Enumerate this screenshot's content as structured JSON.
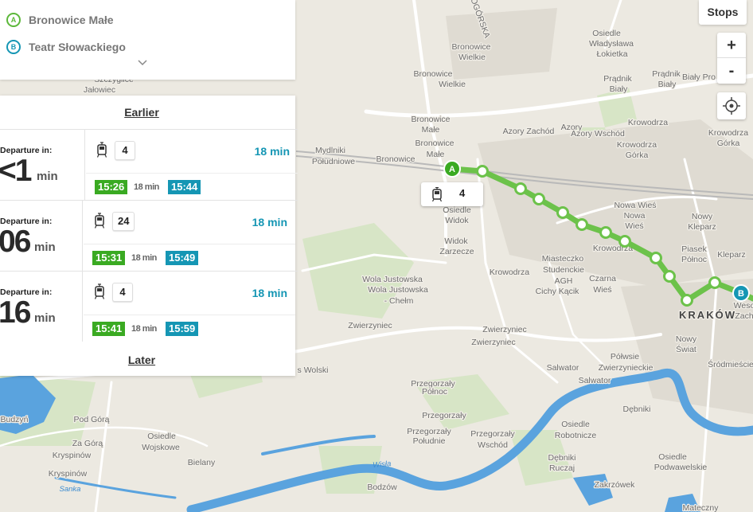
{
  "origin": {
    "marker": "A",
    "name": "Bronowice Małe",
    "color": "#5cb83a"
  },
  "destination": {
    "marker": "B",
    "name": "Teatr Słowackiego",
    "color": "#1596b4"
  },
  "departures_panel": {
    "earlier_label": "Earlier",
    "later_label": "Later",
    "trips": [
      {
        "caption": "Departure in:",
        "big": "<1",
        "unit": "min",
        "line": "4",
        "duration": "18 min",
        "dep_time": "15:26",
        "ride": "18 min",
        "arr_time": "15:44"
      },
      {
        "caption": "Departure in:",
        "big": "06",
        "unit": "min",
        "line": "24",
        "duration": "18 min",
        "dep_time": "15:31",
        "ride": "18 min",
        "arr_time": "15:49"
      },
      {
        "caption": "Departure in:",
        "big": "16",
        "unit": "min",
        "line": "4",
        "duration": "18 min",
        "dep_time": "15:41",
        "ride": "18 min",
        "arr_time": "15:59"
      }
    ]
  },
  "map_controls": {
    "stops_label": "Stops",
    "zoom_in": "+",
    "zoom_out": "-",
    "locate_icon": "crosshair-icon"
  },
  "map_tooltip": {
    "icon": "tram-icon",
    "line": "4"
  },
  "map": {
    "colors": {
      "route": "#6cc24a",
      "water": "#5aa3de",
      "rail": "#b5b5b5",
      "road": "#ffffff"
    },
    "labels": [
      "Pradnik Biały",
      "Azory",
      "Azory Wschód",
      "Azory Zachód",
      "Bronowice Wielkie",
      "Bronowice Małe",
      "Bronowice",
      "Mydlniki Południowe",
      "Widok Zarzecze",
      "Osiedle Widok",
      "Krowodrza",
      "Krowodrza Górka",
      "Nowa Wieś",
      "Nowy Kleparz",
      "Piasek Północ",
      "Miasteczko Studenckie AGH",
      "Czarna Wieś",
      "Cichy Kącik",
      "Wola Justowska",
      "Wola Justowska - Chełm",
      "Zwierzyniec",
      "Salwator",
      "Półwsie Zwierzynieckie",
      "Nowy Świat",
      "Śródmieście",
      "Dębniki",
      "Przegorzały",
      "Przegorzały Północ",
      "Przegorzały Południe",
      "Osiedle Robotnicze",
      "Osiedle Podwawelskie",
      "Zakrzówek",
      "Bodzów",
      "Bielany",
      "Pod Górą",
      "Za Górą",
      "Osiedle Wojskowe",
      "Kryspinów",
      "Budzyń",
      "Wisła",
      "Sanka",
      "KRAKÓW",
      "Osiedle Władysława Łokietka",
      "Prądnik Biały",
      "Szczyglice",
      "Jałowiec",
      "Matecznyn",
      "Kleparz",
      "Wesoła"
    ],
    "route_stops": 13
  }
}
